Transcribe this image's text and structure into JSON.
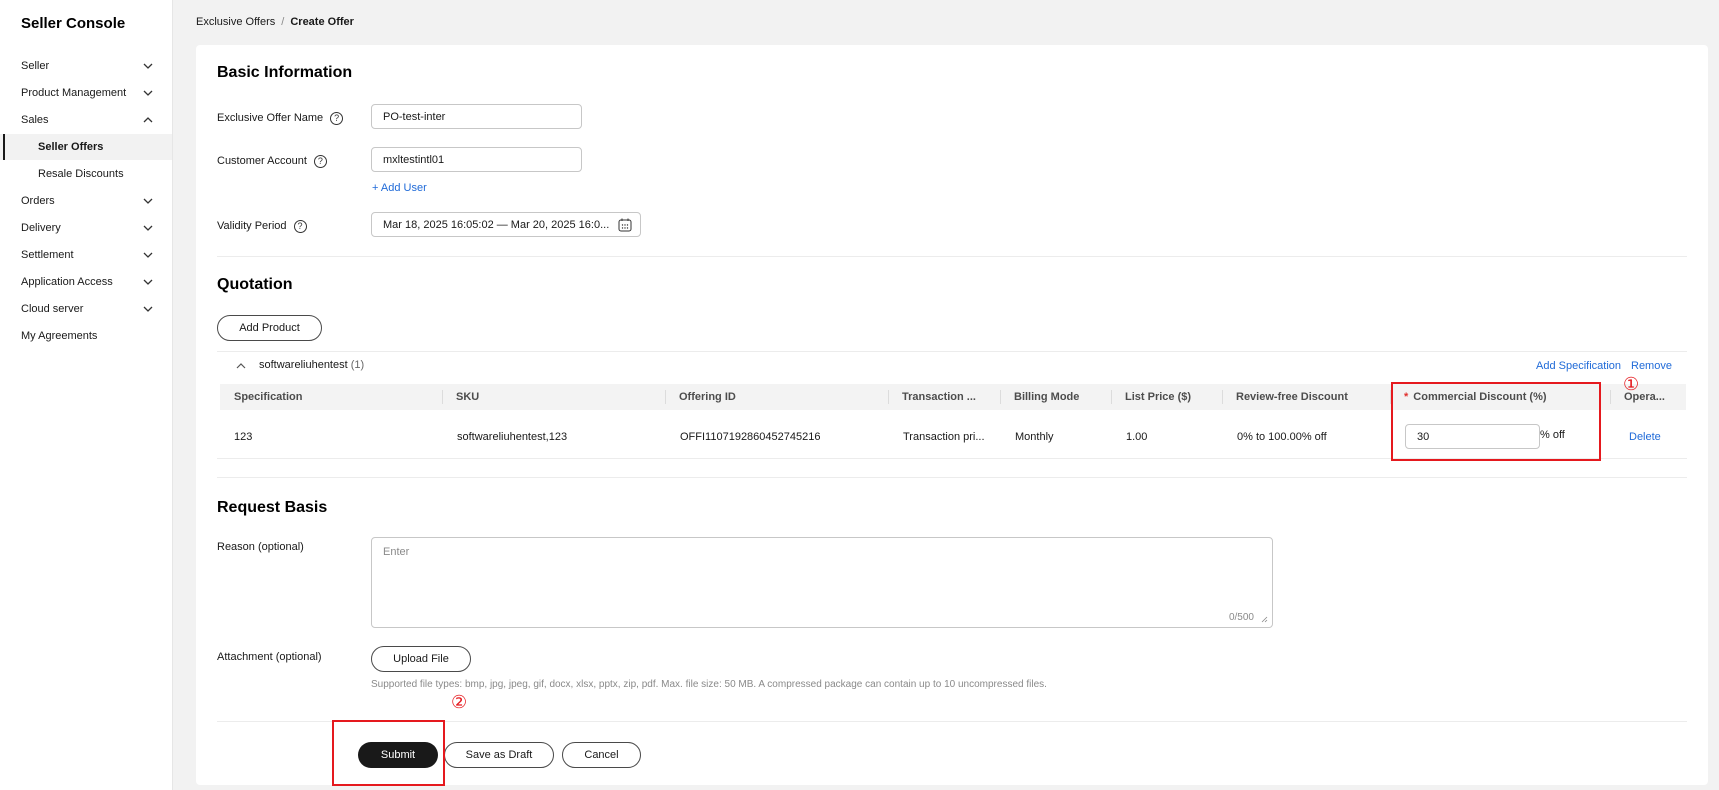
{
  "sidebar": {
    "title": "Seller Console",
    "items": [
      {
        "label": "Seller",
        "chevron": "down"
      },
      {
        "label": "Product Management",
        "chevron": "down"
      },
      {
        "label": "Sales",
        "chevron": "up"
      },
      {
        "label": "Seller Offers",
        "sub": true,
        "active": true
      },
      {
        "label": "Resale Discounts",
        "sub": true
      },
      {
        "label": "Orders",
        "chevron": "down"
      },
      {
        "label": "Delivery",
        "chevron": "down"
      },
      {
        "label": "Settlement",
        "chevron": "down"
      },
      {
        "label": "Application Access",
        "chevron": "down"
      },
      {
        "label": "Cloud server",
        "chevron": "down"
      },
      {
        "label": "My Agreements"
      }
    ]
  },
  "breadcrumb": {
    "parent": "Exclusive Offers",
    "separator": "/",
    "current": "Create Offer"
  },
  "basic": {
    "title": "Basic Information",
    "offer_name_label": "Exclusive Offer Name",
    "offer_name_value": "PO-test-inter",
    "customer_label": "Customer Account",
    "customer_value": "mxltestintl01",
    "add_user": "+ Add User",
    "validity_label": "Validity Period",
    "validity_value": "Mar 18, 2025 16:05:02 — Mar 20, 2025 16:0..."
  },
  "quotation": {
    "title": "Quotation",
    "add_product": "Add Product",
    "group_name": "softwareliuhentest",
    "group_count": "(1)",
    "add_spec": "Add Specification",
    "remove": "Remove",
    "headers": [
      "Specification",
      "SKU",
      "Offering ID",
      "Transaction ...",
      "Billing Mode",
      "List Price ($)",
      "Review-free Discount",
      "Commercial Discount (%)",
      "Opera..."
    ],
    "required_mark": "*",
    "row": {
      "spec": "123",
      "sku": "softwareliuhentest,123",
      "offering_id": "OFFI1107192860452745216",
      "transaction": "Transaction pri...",
      "billing": "Monthly",
      "list_price": "1.00",
      "review_free": "0% to 100.00% off",
      "discount_value": "30",
      "discount_suffix": "% off",
      "delete": "Delete"
    }
  },
  "request": {
    "title": "Request Basis",
    "reason_label": "Reason (optional)",
    "reason_placeholder": "Enter",
    "reason_count": "0/500",
    "attachment_label": "Attachment (optional)",
    "upload": "Upload File",
    "hint": "Supported file types: bmp, jpg, jpeg, gif, docx, xlsx, pptx, zip, pdf. Max. file size: 50 MB. A compressed package can contain up to 10 uncompressed files."
  },
  "footer": {
    "submit": "Submit",
    "draft": "Save as Draft",
    "cancel": "Cancel"
  },
  "annotations": {
    "one": "①",
    "two": "②",
    "color": "#e5191e"
  }
}
